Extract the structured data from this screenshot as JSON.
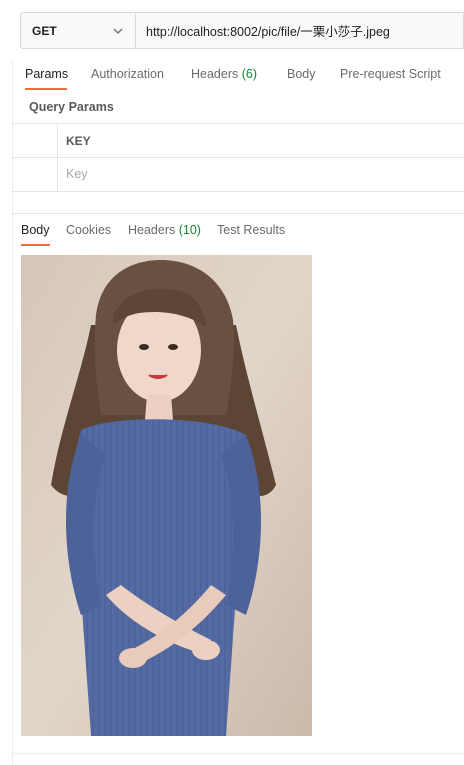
{
  "request": {
    "method": "GET",
    "url": "http://localhost:8002/pic/file/一栗小莎子.jpeg"
  },
  "request_tabs": {
    "params": "Params",
    "authorization": "Authorization",
    "headers": "Headers",
    "headers_count": "(6)",
    "body": "Body",
    "pre_request": "Pre-request Script"
  },
  "query_params": {
    "title": "Query Params",
    "key_header": "KEY",
    "key_placeholder": "Key"
  },
  "response_tabs": {
    "body": "Body",
    "cookies": "Cookies",
    "headers": "Headers",
    "headers_count": "(10)",
    "test_results": "Test Results"
  },
  "colors": {
    "accent": "#f26b3a",
    "count_green": "#0f8a2f",
    "dress_blue": "#5870a8"
  }
}
